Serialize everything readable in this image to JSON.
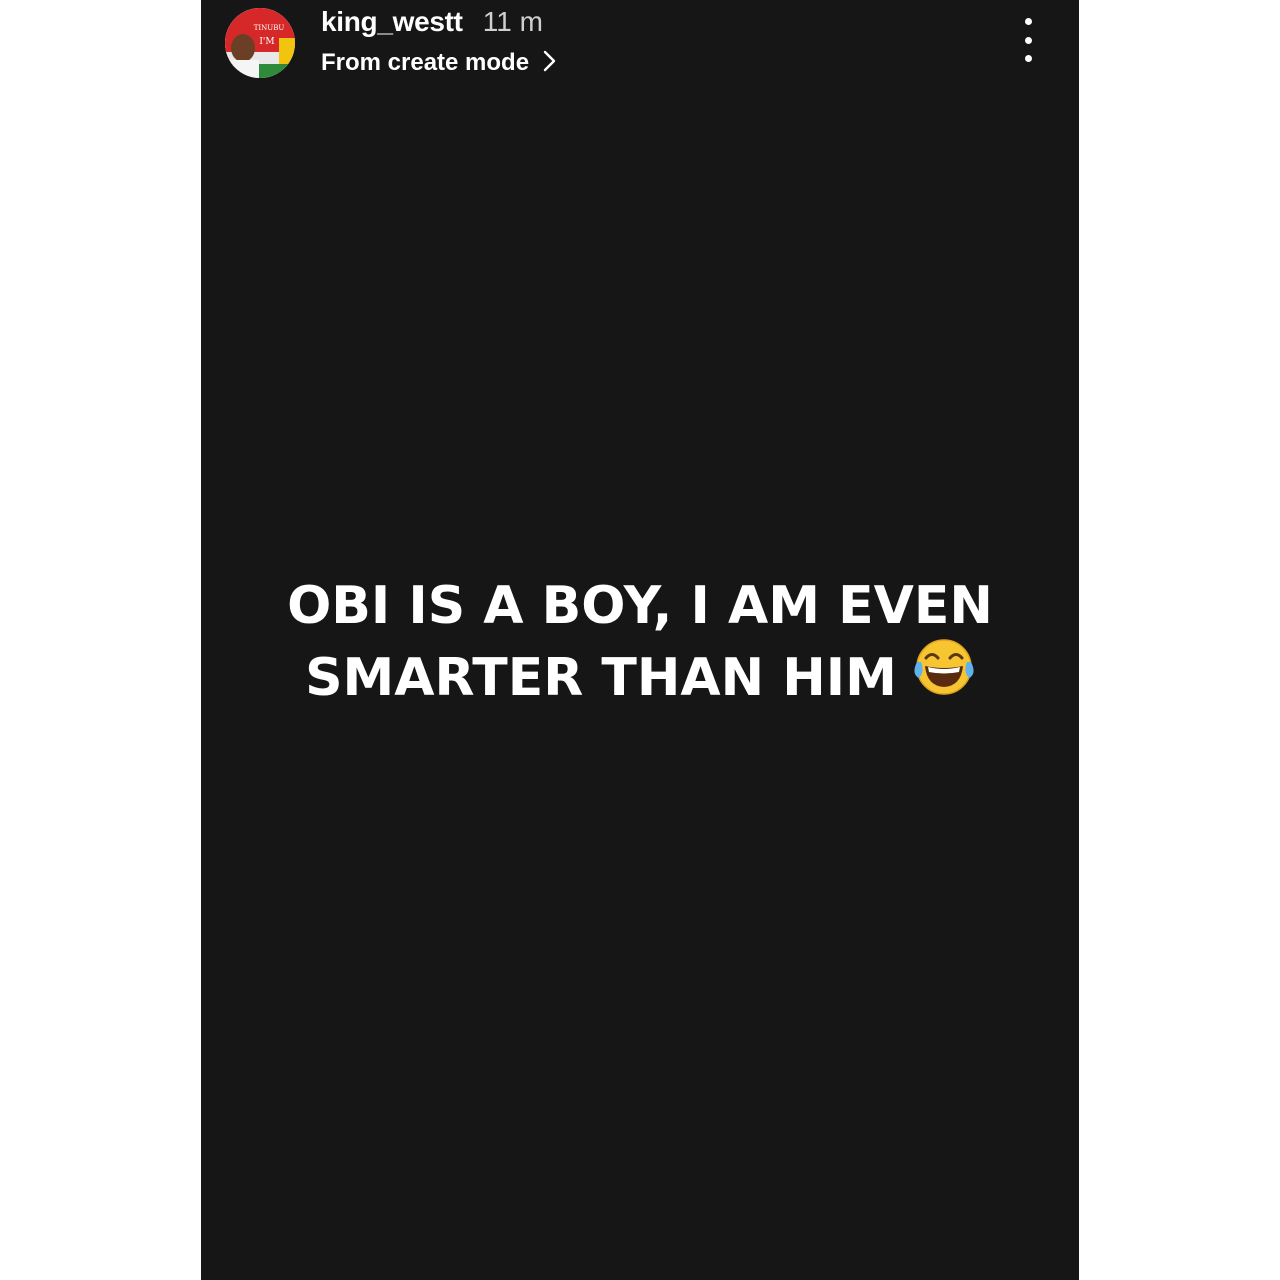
{
  "story": {
    "username": "king_westt",
    "timestamp": "11 m",
    "subtitle": "From create mode",
    "text_line_1": "OBI IS A BOY, I AM EVEN",
    "text_line_2": "SMARTER THAN HIM",
    "emoji": "face-with-tears-of-joy",
    "avatar_text": [
      "TINUBU",
      "I'M"
    ],
    "colors": {
      "background": "#161616",
      "text": "#ffffff",
      "timestamp": "#cfcfcf",
      "page": "#ffffff"
    }
  }
}
